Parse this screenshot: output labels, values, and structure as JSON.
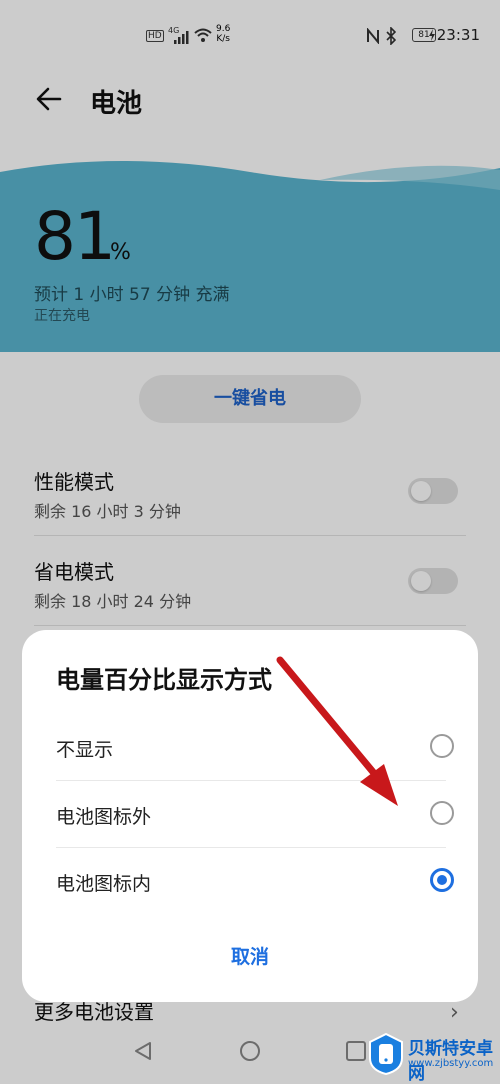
{
  "status_bar": {
    "hd": "HD",
    "signal": "4G",
    "net_speed": "9.6",
    "net_unit": "K/s",
    "battery": "81",
    "time": "23:31"
  },
  "header": {
    "title": "电池"
  },
  "battery": {
    "level": "81",
    "unit": "%",
    "estimate": "预计 1 小时 57 分钟 充满",
    "status": "正在充电",
    "accent_color": "#5bb5cf"
  },
  "power_save_button": {
    "label": "一键省电"
  },
  "settings": [
    {
      "title": "性能模式",
      "subtitle": "剩余 16 小时 3 分钟",
      "enabled": false
    },
    {
      "title": "省电模式",
      "subtitle": "剩余 18 小时 24 分钟",
      "enabled": false
    }
  ],
  "more_settings": {
    "label": "更多电池设置"
  },
  "dialog": {
    "title": "电量百分比显示方式",
    "options": [
      {
        "label": "不显示",
        "selected": false
      },
      {
        "label": "电池图标外",
        "selected": false
      },
      {
        "label": "电池图标内",
        "selected": true
      }
    ],
    "cancel_label": "取消"
  },
  "watermark": {
    "name": "贝斯特安卓网",
    "url": "www.zjbstyy.com"
  }
}
